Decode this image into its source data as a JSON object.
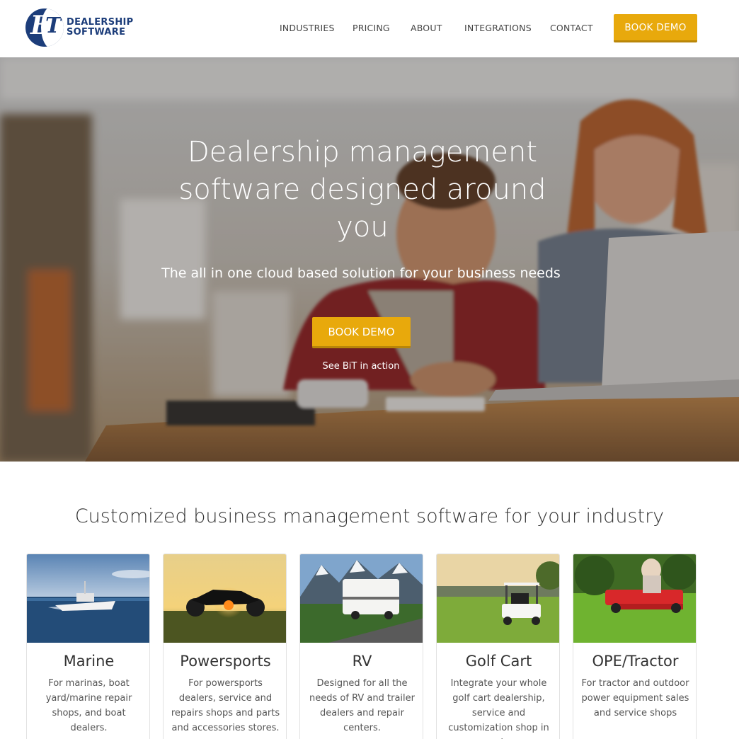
{
  "brand": {
    "line1": "DEALERSHIP",
    "line2": "SOFTWARE",
    "mark_b": "B",
    "mark_t": "T",
    "color": "#1c3d7a"
  },
  "nav": {
    "items": [
      {
        "label": "INDUSTRIES"
      },
      {
        "label": "PRICING"
      },
      {
        "label": "ABOUT"
      },
      {
        "label": "INTEGRATIONS"
      },
      {
        "label": "CONTACT"
      }
    ],
    "cta": "BOOK DEMO"
  },
  "accent": "#e8a90c",
  "hero": {
    "title": "Dealership management software designed around you",
    "subtitle": "The all in one cloud based solution for your business needs",
    "cta": "BOOK DEMO",
    "link": "See BiT in action"
  },
  "section": {
    "title": "Customized business management software for your industry",
    "cards": [
      {
        "name": "Marine",
        "desc": "For marinas, boat yard/marine repair shops, and boat dealers.",
        "image": "boat-image"
      },
      {
        "name": "Powersports",
        "desc": "For powersports dealers, service and repairs shops and parts and accessories stores.",
        "image": "motorcycle-image"
      },
      {
        "name": "RV",
        "desc": "Designed for all the needs of RV and trailer dealers and repair centers.",
        "image": "rv-image"
      },
      {
        "name": "Golf Cart",
        "desc": "Integrate your whole golf cart dealership, service and customization shop in one place.",
        "image": "golf-cart-image"
      },
      {
        "name": "OPE/Tractor",
        "desc": "For tractor and outdoor power equipment sales and service shops",
        "image": "tractor-image"
      }
    ]
  }
}
